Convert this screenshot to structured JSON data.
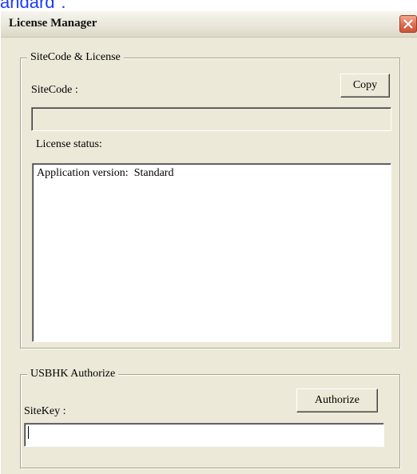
{
  "backdrop": {
    "text": "andard\"."
  },
  "window": {
    "title": "License Manager",
    "close_icon": "close-x-icon"
  },
  "sitecode_group": {
    "legend": "SiteCode & License",
    "sitecode_label": "SiteCode :",
    "copy_button_label": "Copy",
    "sitecode_value": "",
    "license_status_label": "License status:",
    "license_status_text": "Application version:  Standard"
  },
  "authorize_group": {
    "legend": "USBHK Authorize",
    "authorize_button_label": "Authorize",
    "sitekey_label": "SiteKey :",
    "sitekey_value": ""
  }
}
